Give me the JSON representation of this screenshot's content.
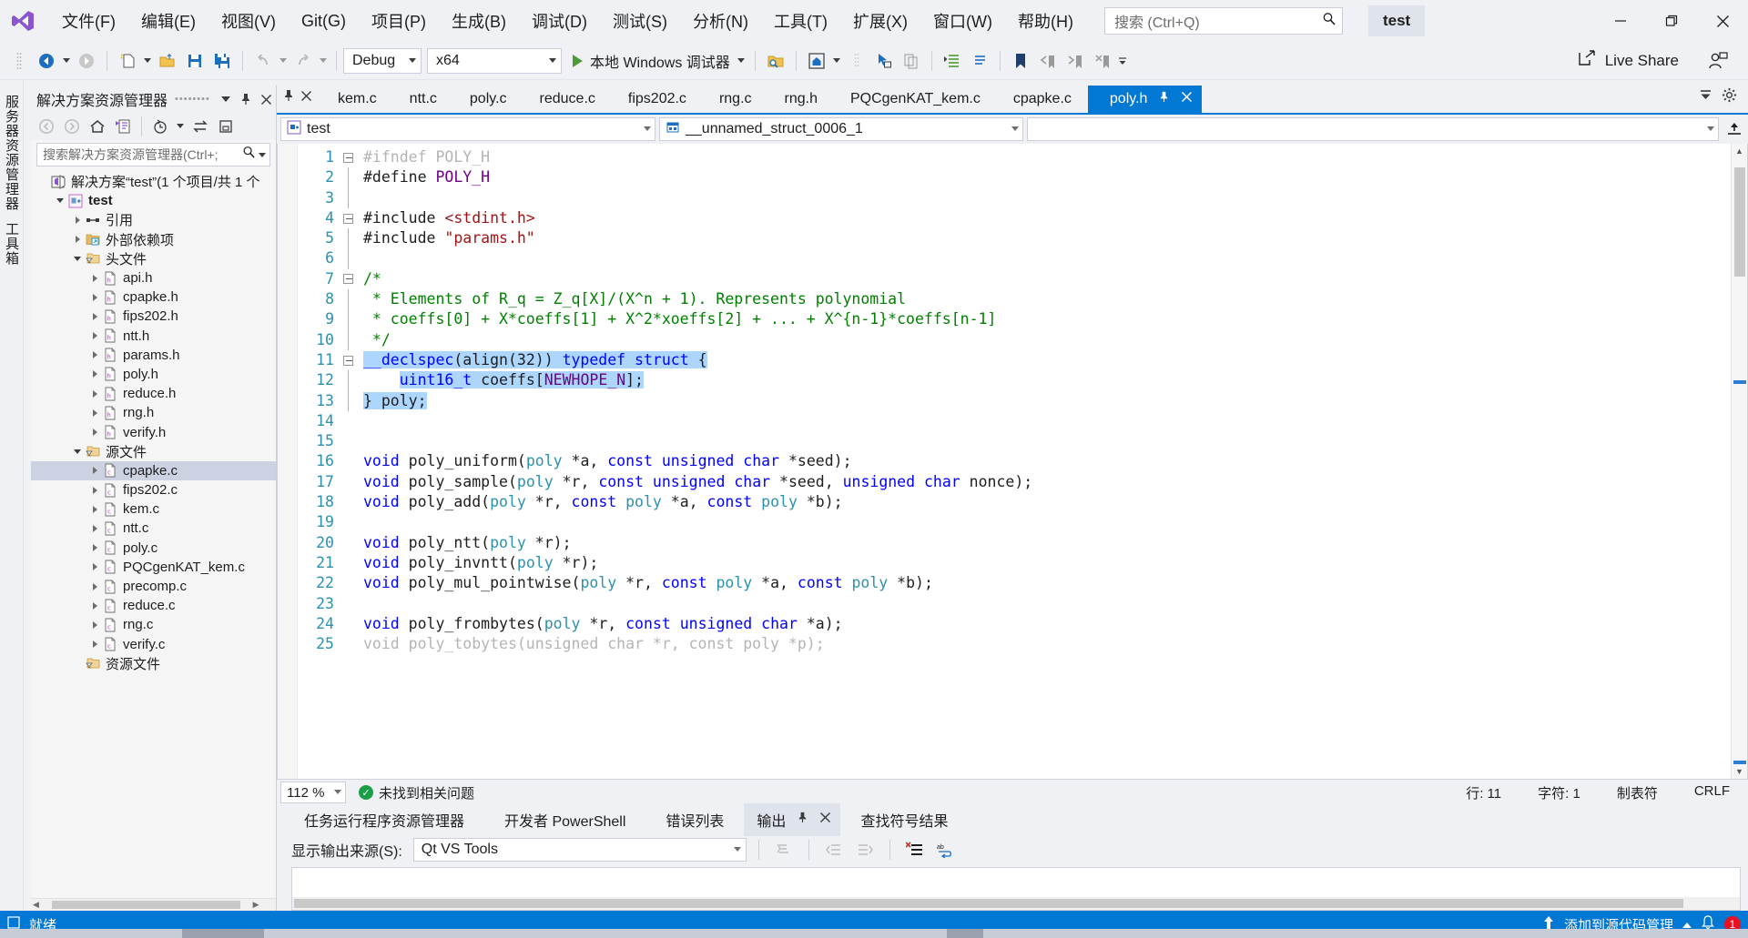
{
  "window": {
    "project_title": "test",
    "minimize": "—",
    "maximize": "❐",
    "close": "✕"
  },
  "menu": {
    "items": [
      {
        "label": "文件(F)",
        "name": "menu-file"
      },
      {
        "label": "编辑(E)",
        "name": "menu-edit"
      },
      {
        "label": "视图(V)",
        "name": "menu-view"
      },
      {
        "label": "Git(G)",
        "name": "menu-git"
      },
      {
        "label": "项目(P)",
        "name": "menu-project"
      },
      {
        "label": "生成(B)",
        "name": "menu-build"
      },
      {
        "label": "调试(D)",
        "name": "menu-debug"
      },
      {
        "label": "测试(S)",
        "name": "menu-test"
      },
      {
        "label": "分析(N)",
        "name": "menu-analyze"
      },
      {
        "label": "工具(T)",
        "name": "menu-tools"
      },
      {
        "label": "扩展(X)",
        "name": "menu-extensions"
      },
      {
        "label": "窗口(W)",
        "name": "menu-window"
      },
      {
        "label": "帮助(H)",
        "name": "menu-help"
      }
    ],
    "search_placeholder": "搜索 (Ctrl+Q)"
  },
  "toolbar": {
    "config": "Debug",
    "platform": "x64",
    "run_label": "本地 Windows 调试器",
    "live_share": "Live Share"
  },
  "solution_explorer": {
    "title": "解决方案资源管理器",
    "search_placeholder": "搜索解决方案资源管理器(Ctrl+;",
    "tree": [
      {
        "label": "解决方案“test”(1 个项目/共 1 个",
        "indent": 0,
        "twisty": "none",
        "icon": "solution-icon",
        "bold": false,
        "selected": false
      },
      {
        "label": "test",
        "indent": 1,
        "twisty": "down",
        "icon": "project-icon",
        "bold": true,
        "selected": false
      },
      {
        "label": "引用",
        "indent": 2,
        "twisty": "right",
        "icon": "references-icon",
        "bold": false,
        "selected": false
      },
      {
        "label": "外部依赖项",
        "indent": 2,
        "twisty": "right",
        "icon": "folder-ext-icon",
        "bold": false,
        "selected": false
      },
      {
        "label": "头文件",
        "indent": 2,
        "twisty": "down",
        "icon": "folder-filter-icon",
        "bold": false,
        "selected": false
      },
      {
        "label": "api.h",
        "indent": 3,
        "twisty": "right",
        "icon": "header-file-icon",
        "bold": false,
        "selected": false
      },
      {
        "label": "cpapke.h",
        "indent": 3,
        "twisty": "right",
        "icon": "header-file-icon",
        "bold": false,
        "selected": false
      },
      {
        "label": "fips202.h",
        "indent": 3,
        "twisty": "right",
        "icon": "header-file-icon",
        "bold": false,
        "selected": false
      },
      {
        "label": "ntt.h",
        "indent": 3,
        "twisty": "right",
        "icon": "header-file-icon",
        "bold": false,
        "selected": false
      },
      {
        "label": "params.h",
        "indent": 3,
        "twisty": "right",
        "icon": "header-file-icon",
        "bold": false,
        "selected": false
      },
      {
        "label": "poly.h",
        "indent": 3,
        "twisty": "right",
        "icon": "header-file-icon",
        "bold": false,
        "selected": false
      },
      {
        "label": "reduce.h",
        "indent": 3,
        "twisty": "right",
        "icon": "header-file-icon",
        "bold": false,
        "selected": false
      },
      {
        "label": "rng.h",
        "indent": 3,
        "twisty": "right",
        "icon": "header-file-icon",
        "bold": false,
        "selected": false
      },
      {
        "label": "verify.h",
        "indent": 3,
        "twisty": "right",
        "icon": "header-file-icon",
        "bold": false,
        "selected": false
      },
      {
        "label": "源文件",
        "indent": 2,
        "twisty": "down",
        "icon": "folder-filter-icon",
        "bold": false,
        "selected": false
      },
      {
        "label": "cpapke.c",
        "indent": 3,
        "twisty": "right",
        "icon": "c-file-icon",
        "bold": false,
        "selected": true
      },
      {
        "label": "fips202.c",
        "indent": 3,
        "twisty": "right",
        "icon": "c-file-icon",
        "bold": false,
        "selected": false
      },
      {
        "label": "kem.c",
        "indent": 3,
        "twisty": "right",
        "icon": "c-file-icon",
        "bold": false,
        "selected": false
      },
      {
        "label": "ntt.c",
        "indent": 3,
        "twisty": "right",
        "icon": "c-file-icon",
        "bold": false,
        "selected": false
      },
      {
        "label": "poly.c",
        "indent": 3,
        "twisty": "right",
        "icon": "c-file-icon",
        "bold": false,
        "selected": false
      },
      {
        "label": "PQCgenKAT_kem.c",
        "indent": 3,
        "twisty": "right",
        "icon": "c-file-icon",
        "bold": false,
        "selected": false
      },
      {
        "label": "precomp.c",
        "indent": 3,
        "twisty": "right",
        "icon": "c-file-icon",
        "bold": false,
        "selected": false
      },
      {
        "label": "reduce.c",
        "indent": 3,
        "twisty": "right",
        "icon": "c-file-icon",
        "bold": false,
        "selected": false
      },
      {
        "label": "rng.c",
        "indent": 3,
        "twisty": "right",
        "icon": "c-file-icon",
        "bold": false,
        "selected": false
      },
      {
        "label": "verify.c",
        "indent": 3,
        "twisty": "right",
        "icon": "c-file-icon",
        "bold": false,
        "selected": false
      },
      {
        "label": "资源文件",
        "indent": 2,
        "twisty": "none",
        "icon": "folder-filter-icon",
        "bold": false,
        "selected": false
      }
    ]
  },
  "vertical_rail": {
    "items": [
      "服务器资源管理器",
      "工具箱"
    ]
  },
  "editor": {
    "tabs": [
      {
        "label": "kem.c",
        "active": false
      },
      {
        "label": "ntt.c",
        "active": false
      },
      {
        "label": "poly.c",
        "active": false
      },
      {
        "label": "reduce.c",
        "active": false
      },
      {
        "label": "fips202.c",
        "active": false
      },
      {
        "label": "rng.c",
        "active": false
      },
      {
        "label": "rng.h",
        "active": false
      },
      {
        "label": "PQCgenKAT_kem.c",
        "active": false
      },
      {
        "label": "cpapke.c",
        "active": false
      },
      {
        "label": "poly.h",
        "active": true
      }
    ],
    "nav_project": "test",
    "nav_scope": "__unnamed_struct_0006_1",
    "nav_member": "",
    "first_line_number": 1,
    "lines": [
      {
        "n": 1,
        "fold": "box",
        "segments": [
          {
            "t": "#ifndef POLY_H",
            "c": "faded"
          }
        ]
      },
      {
        "n": 2,
        "fold": "line",
        "segments": [
          {
            "t": "#define ",
            "c": ""
          },
          {
            "t": "POLY_H",
            "c": "mac"
          }
        ]
      },
      {
        "n": 3,
        "fold": "line",
        "segments": []
      },
      {
        "n": 4,
        "fold": "box",
        "segments": [
          {
            "t": "#include ",
            "c": ""
          },
          {
            "t": "<stdint.h>",
            "c": "str"
          }
        ]
      },
      {
        "n": 5,
        "fold": "line",
        "segments": [
          {
            "t": "#include ",
            "c": ""
          },
          {
            "t": "\"params.h\"",
            "c": "str"
          }
        ]
      },
      {
        "n": 6,
        "fold": "line",
        "segments": []
      },
      {
        "n": 7,
        "fold": "box",
        "segments": [
          {
            "t": "/*",
            "c": "cm"
          }
        ]
      },
      {
        "n": 8,
        "fold": "line",
        "segments": [
          {
            "t": " * Elements of R_q = Z_q[X]/(X^n + 1). Represents polynomial",
            "c": "cm"
          }
        ]
      },
      {
        "n": 9,
        "fold": "line",
        "segments": [
          {
            "t": " * coeffs[0] + X*coeffs[1] + X^2*xoeffs[2] + ... + X^{n-1}*coeffs[n-1]",
            "c": "cm"
          }
        ]
      },
      {
        "n": 10,
        "fold": "line",
        "segments": [
          {
            "t": " */",
            "c": "cm"
          }
        ]
      },
      {
        "n": 11,
        "fold": "box",
        "segments": [
          {
            "t": "__declspec",
            "c": "k sel"
          },
          {
            "t": "(",
            "c": "sel"
          },
          {
            "t": "align",
            "c": "sel"
          },
          {
            "t": "(32)) ",
            "c": "sel"
          },
          {
            "t": "typedef",
            "c": "k sel"
          },
          {
            "t": " ",
            "c": "sel"
          },
          {
            "t": "struct",
            "c": "k sel"
          },
          {
            "t": " {",
            "c": "sel"
          }
        ]
      },
      {
        "n": 12,
        "fold": "line",
        "segments": [
          {
            "t": "    ",
            "c": ""
          },
          {
            "t": "uint16_t",
            "c": "k sel"
          },
          {
            "t": " coeffs[",
            "c": "sel"
          },
          {
            "t": "NEWHOPE_N",
            "c": "mac sel"
          },
          {
            "t": "];",
            "c": "sel"
          }
        ]
      },
      {
        "n": 13,
        "fold": "line",
        "segments": [
          {
            "t": "} poly;",
            "c": "sel"
          }
        ]
      },
      {
        "n": 14,
        "fold": "none",
        "segments": []
      },
      {
        "n": 15,
        "fold": "none",
        "segments": []
      },
      {
        "n": 16,
        "fold": "none",
        "segments": [
          {
            "t": "void",
            "c": "k"
          },
          {
            "t": " poly_uniform(",
            "c": ""
          },
          {
            "t": "poly",
            "c": "ty"
          },
          {
            "t": " *a, ",
            "c": ""
          },
          {
            "t": "const",
            "c": "k"
          },
          {
            "t": " ",
            "c": ""
          },
          {
            "t": "unsigned",
            "c": "k"
          },
          {
            "t": " ",
            "c": ""
          },
          {
            "t": "char",
            "c": "k"
          },
          {
            "t": " *seed);",
            "c": ""
          }
        ]
      },
      {
        "n": 17,
        "fold": "none",
        "segments": [
          {
            "t": "void",
            "c": "k"
          },
          {
            "t": " poly_sample(",
            "c": ""
          },
          {
            "t": "poly",
            "c": "ty"
          },
          {
            "t": " *r, ",
            "c": ""
          },
          {
            "t": "const",
            "c": "k"
          },
          {
            "t": " ",
            "c": ""
          },
          {
            "t": "unsigned",
            "c": "k"
          },
          {
            "t": " ",
            "c": ""
          },
          {
            "t": "char",
            "c": "k"
          },
          {
            "t": " *seed, ",
            "c": ""
          },
          {
            "t": "unsigned",
            "c": "k"
          },
          {
            "t": " ",
            "c": ""
          },
          {
            "t": "char",
            "c": "k"
          },
          {
            "t": " nonce);",
            "c": ""
          }
        ]
      },
      {
        "n": 18,
        "fold": "none",
        "segments": [
          {
            "t": "void",
            "c": "k"
          },
          {
            "t": " poly_add(",
            "c": ""
          },
          {
            "t": "poly",
            "c": "ty"
          },
          {
            "t": " *r, ",
            "c": ""
          },
          {
            "t": "const",
            "c": "k"
          },
          {
            "t": " ",
            "c": ""
          },
          {
            "t": "poly",
            "c": "ty"
          },
          {
            "t": " *a, ",
            "c": ""
          },
          {
            "t": "const",
            "c": "k"
          },
          {
            "t": " ",
            "c": ""
          },
          {
            "t": "poly",
            "c": "ty"
          },
          {
            "t": " *b);",
            "c": ""
          }
        ]
      },
      {
        "n": 19,
        "fold": "none",
        "segments": []
      },
      {
        "n": 20,
        "fold": "none",
        "segments": [
          {
            "t": "void",
            "c": "k"
          },
          {
            "t": " poly_ntt(",
            "c": ""
          },
          {
            "t": "poly",
            "c": "ty"
          },
          {
            "t": " *r);",
            "c": ""
          }
        ]
      },
      {
        "n": 21,
        "fold": "none",
        "segments": [
          {
            "t": "void",
            "c": "k"
          },
          {
            "t": " poly_invntt(",
            "c": ""
          },
          {
            "t": "poly",
            "c": "ty"
          },
          {
            "t": " *r);",
            "c": ""
          }
        ]
      },
      {
        "n": 22,
        "fold": "none",
        "segments": [
          {
            "t": "void",
            "c": "k"
          },
          {
            "t": " poly_mul_pointwise(",
            "c": ""
          },
          {
            "t": "poly",
            "c": "ty"
          },
          {
            "t": " *r, ",
            "c": ""
          },
          {
            "t": "const",
            "c": "k"
          },
          {
            "t": " ",
            "c": ""
          },
          {
            "t": "poly",
            "c": "ty"
          },
          {
            "t": " *a, ",
            "c": ""
          },
          {
            "t": "const",
            "c": "k"
          },
          {
            "t": " ",
            "c": ""
          },
          {
            "t": "poly",
            "c": "ty"
          },
          {
            "t": " *b);",
            "c": ""
          }
        ]
      },
      {
        "n": 23,
        "fold": "none",
        "segments": []
      },
      {
        "n": 24,
        "fold": "none",
        "segments": [
          {
            "t": "void",
            "c": "k"
          },
          {
            "t": " poly_frombytes(",
            "c": ""
          },
          {
            "t": "poly",
            "c": "ty"
          },
          {
            "t": " *r, ",
            "c": ""
          },
          {
            "t": "const",
            "c": "k"
          },
          {
            "t": " ",
            "c": ""
          },
          {
            "t": "unsigned",
            "c": "k"
          },
          {
            "t": " ",
            "c": ""
          },
          {
            "t": "char",
            "c": "k"
          },
          {
            "t": " *a);",
            "c": ""
          }
        ]
      },
      {
        "n": 25,
        "fold": "none",
        "segments": [
          {
            "t": "void poly_tobytes(unsigned char *r, const poly *p);",
            "c": "faded"
          }
        ]
      }
    ]
  },
  "editor_status": {
    "zoom": "112 %",
    "issues": "未找到相关问题",
    "line": "行: 11",
    "col": "字符: 1",
    "tabs_mode": "制表符",
    "eol": "CRLF"
  },
  "output_panel": {
    "tabs": [
      {
        "label": "任务运行程序资源管理器",
        "active": false
      },
      {
        "label": "开发者 PowerShell",
        "active": false
      },
      {
        "label": "错误列表",
        "active": false
      },
      {
        "label": "输出",
        "active": true
      },
      {
        "label": "查找符号结果",
        "active": false
      }
    ],
    "source_label": "显示输出来源(S):",
    "source_value": "Qt VS Tools"
  },
  "statusbar": {
    "ready": "就绪",
    "source_control": "添加到源代码管理",
    "notification_count": "1"
  }
}
